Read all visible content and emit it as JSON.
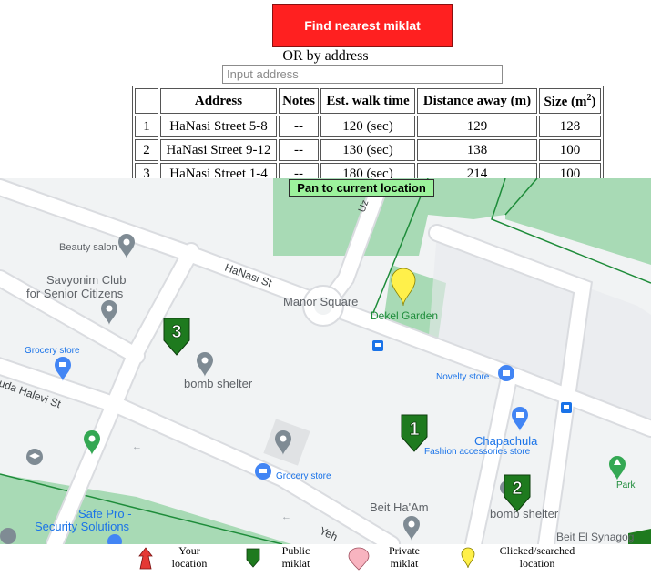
{
  "controls": {
    "find_nearest_label": "Find nearest miklat",
    "or_by_address_label": "OR by address",
    "address_placeholder": "Input address",
    "pan_label": "Pan to current location"
  },
  "table": {
    "headers": [
      "",
      "Address",
      "Notes",
      "Est. walk time",
      "Distance away (m)",
      "Size (m"
    ],
    "size_superscript": "2",
    "rows": [
      {
        "rank": "1",
        "address": "HaNasi Street 5-8",
        "notes": "--",
        "walk": "120 (sec)",
        "distance": "129",
        "size": "128"
      },
      {
        "rank": "2",
        "address": "HaNasi Street 9-12",
        "notes": "--",
        "walk": "130 (sec)",
        "distance": "138",
        "size": "100"
      },
      {
        "rank": "3",
        "address": "HaNasi Street 1-4",
        "notes": "--",
        "walk": "180 (sec)",
        "distance": "214",
        "size": "100"
      }
    ]
  },
  "map": {
    "labels": {
      "beauty_salon": "Beauty salon",
      "savyonim_1": "Savyonim Club",
      "savyonim_2": "for Senior Citizens",
      "hanasi_st": "HaNasi St",
      "manor_square": "Manor Square",
      "dekel_garden": "Dekel Garden",
      "grocery_store_1": "Grocery store",
      "bomb_shelter_1": "bomb shelter",
      "yehuda_halevi": "uda Halevi St",
      "novelty_store": "Novelty store",
      "chapachula": "Chapachula",
      "fashion": "Fashion accessories store",
      "park": "Park",
      "grocery_store_2": "Grocery store",
      "beit_haam": "Beit Ha'Am",
      "bomb_shelter_2": "bomb shelter",
      "safe_pro_1": "Safe Pro -",
      "safe_pro_2": "Security Solutions",
      "beit_el": "Beit El Synagog",
      "uz": "Uz",
      "yeh": "Yeh"
    },
    "miklat_markers": [
      "1",
      "2",
      "3"
    ],
    "colors": {
      "public_miklat": "#1e7a1e",
      "clicked_marker": "#fff04a",
      "your_location": "#e53935",
      "private_miklat": "#f8b4c0",
      "park_green": "#a8dab5",
      "poi_gray": "#7f8b94",
      "poi_blue": "#4285f4",
      "poi_green": "#34a853"
    }
  },
  "legend": {
    "your_location": [
      "Your",
      "location"
    ],
    "public_miklat": [
      "Public",
      "miklat"
    ],
    "private_miklat": [
      "Private",
      "miklat"
    ],
    "clicked": [
      "Clicked/searched",
      "location"
    ]
  }
}
